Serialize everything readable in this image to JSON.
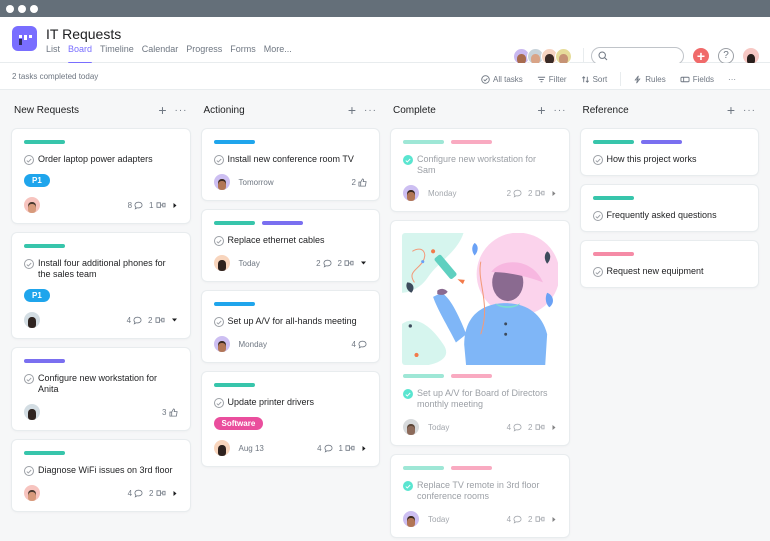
{
  "window": {
    "controls": [
      "close",
      "minimize",
      "maximize"
    ]
  },
  "header": {
    "title": "IT Requests",
    "logo_color": "#796eff",
    "tabs": [
      {
        "label": "List",
        "active": false
      },
      {
        "label": "Board",
        "active": true
      },
      {
        "label": "Timeline",
        "active": false
      },
      {
        "label": "Calendar",
        "active": false
      },
      {
        "label": "Progress",
        "active": false
      },
      {
        "label": "Forms",
        "active": false
      },
      {
        "label": "More...",
        "active": false
      }
    ],
    "members_count": 4,
    "search_placeholder": "",
    "add_icon": "plus-icon",
    "help_label": "?"
  },
  "subbar": {
    "status": "2 tasks completed today",
    "tools": {
      "all_tasks": "All tasks",
      "filter": "Filter",
      "sort": "Sort",
      "rules": "Rules",
      "fields": "Fields",
      "more": "···"
    }
  },
  "colors": {
    "teal": "#37c5ab",
    "blue": "#1fa5ec",
    "purple": "#7a6ff0",
    "pink": "#f9aac1",
    "pink_ref": "#f58ba6",
    "teal_light": "#9ee7d6",
    "p1": "#1fa5ec",
    "software": "#ea4e9d",
    "accent": "#796eff",
    "add_button": "#f06a6a"
  },
  "columns": [
    {
      "name": "New Requests",
      "cards": [
        {
          "bars": [
            "teal"
          ],
          "title": "Order laptop power adapters",
          "tag": "P1",
          "tag_color": "p1",
          "avatar": "man-beard",
          "comments": "8",
          "subtasks": "1",
          "expander": "right"
        },
        {
          "bars": [
            "teal"
          ],
          "title": "Install four additional phones for the sales team",
          "tag": "P1",
          "tag_color": "p1",
          "avatar": "woman-dark-hair",
          "comments": "4",
          "subtasks": "2",
          "expander": "down"
        },
        {
          "bars": [
            "purple"
          ],
          "title": "Configure new workstation for Anita",
          "avatar": "woman-dark-hair",
          "likes": "3"
        },
        {
          "bars": [
            "teal"
          ],
          "title": "Diagnose WiFi issues on 3rd floor",
          "avatar": "man-beard",
          "comments": "4",
          "subtasks": "2",
          "expander": "right"
        }
      ]
    },
    {
      "name": "Actioning",
      "cards": [
        {
          "bars": [
            "blue"
          ],
          "title": "Install new conference room TV",
          "avatar": "man-purple-bg",
          "due": "Tomorrow",
          "likes": "2"
        },
        {
          "bars": [
            "teal",
            "purple"
          ],
          "title": "Replace ethernet cables",
          "avatar": "woman-peach-bg",
          "due": "Today",
          "comments": "2",
          "subtasks": "2",
          "expander": "down"
        },
        {
          "bars": [
            "blue"
          ],
          "title": "Set up A/V for all-hands meeting",
          "avatar": "man-purple-bg",
          "due": "Monday",
          "comments": "4"
        },
        {
          "bars": [
            "teal"
          ],
          "title": "Update printer drivers",
          "tag": "Software",
          "tag_color": "software",
          "avatar": "woman-peach-bg",
          "due": "Aug 13",
          "comments": "4",
          "subtasks": "1",
          "expander": "right"
        }
      ]
    },
    {
      "name": "Complete",
      "cards": [
        {
          "bars": [
            "teal_light",
            "pink"
          ],
          "title": "Configure new workstation for Sam",
          "completed": true,
          "avatar": "man-purple-bg",
          "due": "Monday",
          "comments": "2",
          "subtasks": "2",
          "expander": "right"
        },
        {
          "bars": [
            "teal_light",
            "pink"
          ],
          "title": "Set up A/V for Board of Directors monthly meeting",
          "completed": true,
          "has_image": true,
          "image_alt": "Illustration of a woman with pink hair holding a pencil",
          "avatar": "woman-grey-bg",
          "due": "Today",
          "comments": "4",
          "subtasks": "2",
          "expander": "right"
        },
        {
          "bars": [
            "teal_light",
            "pink"
          ],
          "title": "Replace TV remote in 3rd floor conference rooms",
          "completed": true,
          "avatar": "man-purple-bg",
          "due": "Today",
          "comments": "4",
          "subtasks": "2",
          "expander": "right"
        }
      ]
    },
    {
      "name": "Reference",
      "cards": [
        {
          "bars": [
            "teal",
            "purple"
          ],
          "title": "How this project works"
        },
        {
          "bars": [
            "teal"
          ],
          "title": "Frequently asked questions"
        },
        {
          "bars": [
            "pink_ref"
          ],
          "title": "Request new equipment"
        }
      ]
    }
  ]
}
